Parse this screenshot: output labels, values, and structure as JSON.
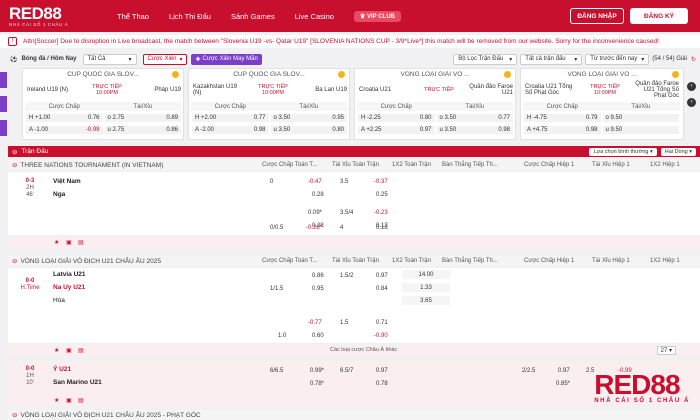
{
  "header": {
    "logo": "RED88",
    "logo_tagline": "NHÀ CÁI SỐ 1 CHÂU Á",
    "nav": [
      "Thể Thao",
      "Lịch Thi Đấu",
      "Sảnh Games",
      "Live Casino"
    ],
    "vip_label": "VIP CLUB",
    "login_label": "ĐĂNG NHẬP",
    "register_label": "ĐĂNG KÝ"
  },
  "announcement": "Attn[Soccer] Due to disruption in Live broadcast, the match between \"Slovenia U19 -vs- Qatar U19\" [SLOVENIA NATIONS CUP - 3/9*Live*] this match will be removed from our website. Sorry for the inconvenience caused!",
  "filters": {
    "sport": "Bóng đá / Hôm Nay",
    "all": "Tất Cả",
    "parlay": "Cược Xiên",
    "lucky_parlay": "Cược Xiên May Mắn",
    "league_filter": "Bộ Lọc Trận Đấu",
    "all_matches": "Tất cả trận đấu",
    "sort": "Từ trước đến nay",
    "count": "(54 / 54) Giải"
  },
  "featured": [
    {
      "title": "CÚP QUỐC GIA SLOV...",
      "home": "Ireland U19 (N)",
      "away": "Pháp U19",
      "live": "TRỰC TIẾP",
      "time": "10:00PM",
      "hdp_label": "Cược Chấp",
      "ou_label": "Tài/Xỉu",
      "rows": [
        {
          "h": "H +1.00",
          "hv": "0.76",
          "o": "o 2.75",
          "ov": "0.89"
        },
        {
          "h": "A -1.00",
          "hv": "-0.99",
          "o": "u 2.75",
          "ov": "0.86"
        }
      ]
    },
    {
      "title": "CÚP QUỐC GIA SLOV...",
      "home": "Kazakhstan U19 (N)",
      "away": "Ba Lan U19",
      "live": "TRỰC TIẾP",
      "time": "10:00PM",
      "hdp_label": "Cược Chấp",
      "ou_label": "Tài/Xỉu",
      "rows": [
        {
          "h": "H +2.00",
          "hv": "0.77",
          "o": "o 3.50",
          "ov": "0.95"
        },
        {
          "h": "A -2.00",
          "hv": "0.98",
          "o": "u 3.50",
          "ov": "0.80"
        }
      ]
    },
    {
      "title": "VÒNG LOẠI GIẢI VÔ ...",
      "home": "Croatia U21",
      "away": "Quần đảo Faroe U21",
      "live": "TRỰC TIẾP",
      "time": "",
      "hdp_label": "Cược Chấp",
      "ou_label": "Tài/Xỉu",
      "rows": [
        {
          "h": "H -2.25",
          "hv": "0.80",
          "o": "o 3.50",
          "ov": "0.77"
        },
        {
          "h": "A +2.25",
          "hv": "0.97",
          "o": "u 3.50",
          "ov": "0.98"
        }
      ]
    },
    {
      "title": "VÒNG LOẠI GIẢI VÔ ...",
      "home": "Croatia U21 Tổng Số Phạt Góc",
      "away": "Quần đảo Faroe U21 Tổng Số Phạt Góc",
      "live": "TRỰC TIẾP",
      "time": "10:00PM",
      "hdp_label": "Cược Chấp",
      "ou_label": "Tài/Xỉu",
      "rows": [
        {
          "h": "H -4.75",
          "hv": "0.79",
          "o": "o 9.50",
          "ov": ""
        },
        {
          "h": "A +4.75",
          "hv": "0.98",
          "o": "u 9.50",
          "ov": ""
        }
      ]
    }
  ],
  "section": {
    "title": "Trận Đấu",
    "sort_label": "Lựa chọn bình thường",
    "odds_label": "Hai Dòng"
  },
  "columns": [
    "Cược Chấp Toàn T...",
    "Tài Xỉu Toàn Trận",
    "1X2 Toàn Trận",
    "Bàn Thắng Tiếp Th...",
    "Cược Chấp Hiệp 1",
    "Tài Xỉu Hiệp 1",
    "1X2 Hiệp 1"
  ],
  "leagues": [
    {
      "name": "THREE NATIONS TOURNAMENT (IN VIETNAM)",
      "score": "0-3",
      "period": "2H",
      "minute": "46'",
      "home": "Việt Nam",
      "away": "Nga",
      "draw": "",
      "lines": [
        {
          "hdp": "0",
          "hdp1": "-0.47",
          "hdp2": "0.28",
          "ou": "3.5",
          "ou1": "-0.37",
          "ou2": "0.25"
        },
        {
          "hdp": "",
          "hdp1": "0.09*",
          "hdp2": "0.28",
          "ou": "3.5/4",
          "ou1": "-0.23",
          "ou2": "0.13"
        },
        {
          "hdp": "0/0.5",
          "hdp1": "-0.28*",
          "hdp2": "",
          "ou": "4",
          "ou1": "0.18",
          "ou2": ""
        }
      ]
    },
    {
      "name": "VÒNG LOẠI GIẢI VÔ ĐỊCH U21 CHÂU ÂU 2025",
      "score": "0-0",
      "period": "H.Time",
      "minute": "",
      "home": "Latvia U21",
      "away": "Na Uy U21",
      "draw": "Hòa",
      "x12": [
        "14.00",
        "1.33",
        "3.65"
      ],
      "more": "Các loại cược Châu Á khác",
      "more_count": "27",
      "lines": [
        {
          "hdp": "",
          "hdp1": "0.86",
          "hdp2": "",
          "ou": "1.5/2",
          "ou1": "0.97",
          "ou2": ""
        },
        {
          "hdp": "1/1.5",
          "hdp1": "0.95",
          "hdp2": "",
          "ou": "",
          "ou1": "0.84",
          "ou2": ""
        },
        {
          "hdp": "",
          "hdp1": "-0.77",
          "hdp2": "0.60",
          "ou": "1.5",
          "ou1": "0.71",
          "ou2": "-0.90"
        },
        {
          "hdp": "1.0",
          "hdp1": "",
          "hdp2": "",
          "ou": "",
          "ou1": "",
          "ou2": ""
        }
      ]
    },
    {
      "name": "",
      "score": "0-0",
      "period": "1H",
      "minute": "10'",
      "home": "Ý U21",
      "away": "San Marino U21",
      "lines": [
        {
          "hdp": "6/6.5",
          "hdp1": "0.99*",
          "hdp2": "0.78*",
          "ou": "6.5/7",
          "ou1": "0.97",
          "ou2": "0.78"
        }
      ],
      "h1": {
        "hdp": "2/2.5",
        "hdp1": "0.97",
        "hdp2": "0.85*",
        "ou": "2.5",
        "ou1": "-0.99"
      }
    },
    {
      "name": "VÒNG LOẠI GIẢI VÔ ĐỊCH U21 CHÂU ÂU 2025 - PHẠT GÓC"
    }
  ],
  "watermark": {
    "logo": "RED88",
    "tagline": "NHÀ CÁI SỐ 1 CHÂU Á"
  },
  "colors": {
    "brand": "#c8102e",
    "accent_purple": "#7b3ec7",
    "gold": "#f3b31d"
  }
}
